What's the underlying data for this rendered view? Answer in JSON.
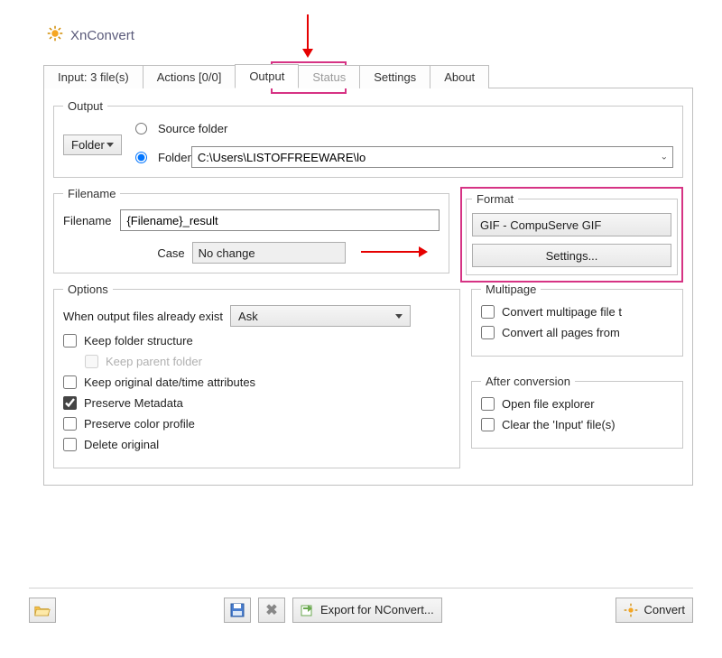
{
  "app": {
    "title": "XnConvert"
  },
  "tabs": {
    "input": "Input: 3 file(s)",
    "actions": "Actions [0/0]",
    "output": "Output",
    "status": "Status",
    "settings": "Settings",
    "about": "About"
  },
  "output": {
    "legend": "Output",
    "folder_btn": "Folder",
    "source_radio": "Source folder",
    "folder_radio": "Folder",
    "path": "C:\\Users\\LISTOFFREEWARE\\lo"
  },
  "filename": {
    "legend": "Filename",
    "label": "Filename",
    "value": "{Filename}_result",
    "case_label": "Case",
    "case_value": "No change"
  },
  "format": {
    "legend": "Format",
    "selected": "GIF - CompuServe GIF",
    "settings_btn": "Settings..."
  },
  "options": {
    "legend": "Options",
    "exist_label": "When output files already exist",
    "exist_value": "Ask",
    "keep_folder": "Keep folder structure",
    "keep_parent": "Keep parent folder",
    "keep_date": "Keep original date/time attributes",
    "preserve_meta": "Preserve Metadata",
    "preserve_color": "Preserve color profile",
    "delete_orig": "Delete original"
  },
  "multipage": {
    "legend": "Multipage",
    "convert_multipage": "Convert multipage file t",
    "convert_all": "Convert all pages from"
  },
  "after": {
    "legend": "After conversion",
    "open_explorer": "Open file explorer",
    "clear_input": "Clear the 'Input' file(s)"
  },
  "bottom": {
    "export": "Export for NConvert...",
    "convert": "Convert"
  }
}
